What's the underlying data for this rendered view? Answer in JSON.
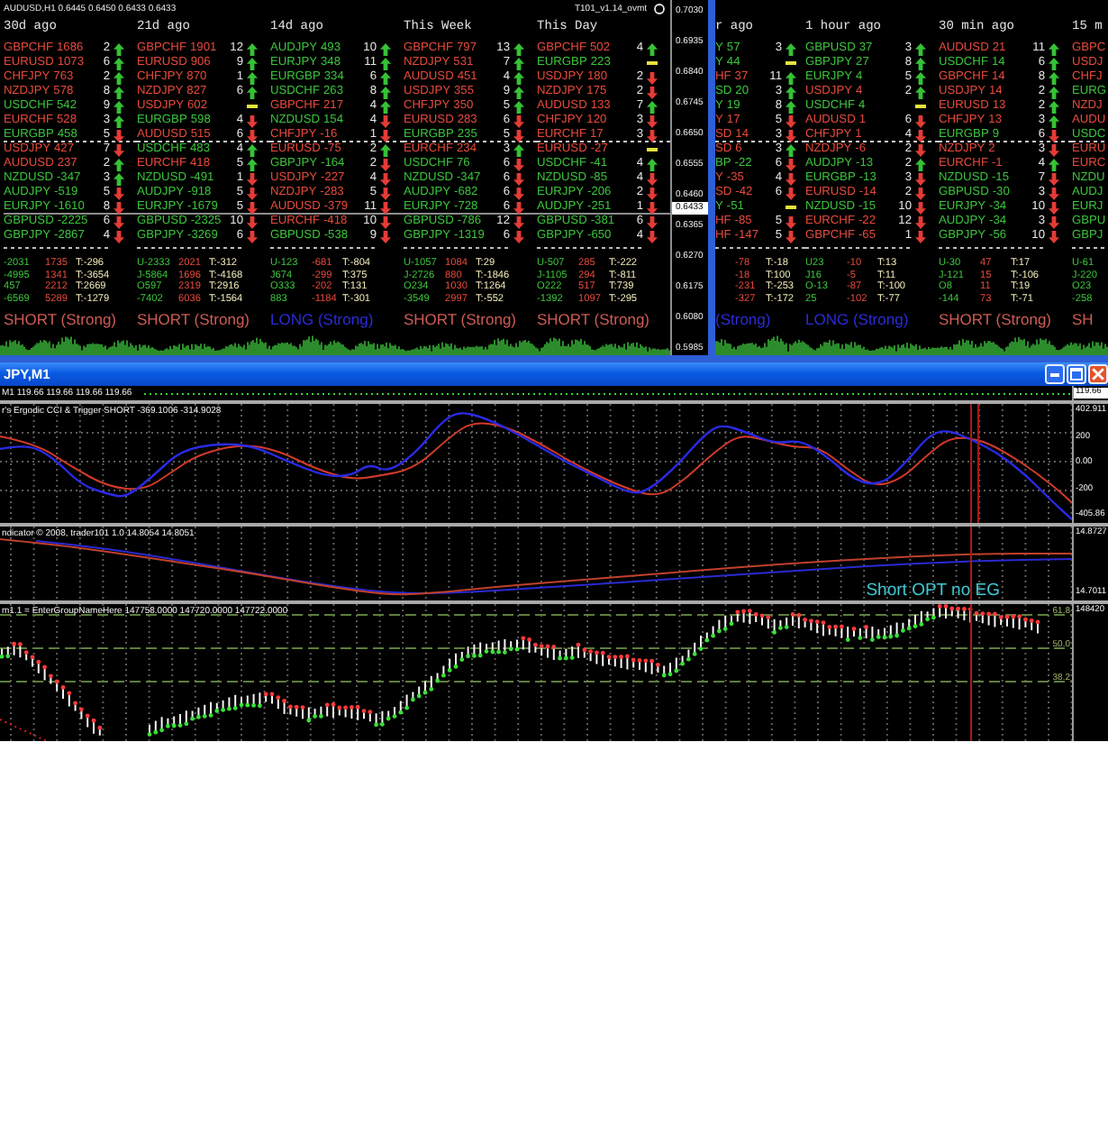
{
  "top_windows": [
    {
      "header": {
        "symbol": "AUDUSD,H1 0.6445 0.6450 0.6433 0.6433",
        "indicator": "T101_v1.14_ovmt"
      },
      "columns": [
        {
          "title": "30d ago",
          "rows": [
            {
              "pair": "GBPCHF",
              "value": "1686",
              "count": "2",
              "kind": "up",
              "color": "#e64a3c"
            },
            {
              "pair": "EURUSD",
              "value": "1073",
              "count": "6",
              "kind": "up",
              "color": "#e64a3c"
            },
            {
              "pair": "CHFJPY",
              "value": "763",
              "count": "2",
              "kind": "up",
              "color": "#e64a3c"
            },
            {
              "pair": "NZDJPY",
              "value": "578",
              "count": "8",
              "kind": "up",
              "color": "#e64a3c"
            },
            {
              "pair": "USDCHF",
              "value": "542",
              "count": "9",
              "kind": "up",
              "color": "#3cc33c"
            },
            {
              "pair": "EURCHF",
              "value": "528",
              "count": "3",
              "kind": "up",
              "color": "#e64a3c"
            },
            {
              "pair": "EURGBP",
              "value": "458",
              "count": "5",
              "kind": "down",
              "color": "#3cc33c"
            },
            {
              "pair": "USDJPY",
              "value": "427",
              "count": "7",
              "kind": "down",
              "color": "#e64a3c"
            },
            {
              "pair": "AUDUSD",
              "value": "237",
              "count": "2",
              "kind": "up",
              "color": "#e64a3c"
            },
            {
              "pair": "NZDUSD",
              "value": "-347",
              "count": "3",
              "kind": "up",
              "color": "#3cc33c"
            },
            {
              "pair": "AUDJPY",
              "value": "-519",
              "count": "5",
              "kind": "down",
              "color": "#3cc33c"
            },
            {
              "pair": "EURJPY",
              "value": "-1610",
              "count": "8",
              "kind": "down",
              "color": "#3cc33c"
            },
            {
              "pair": "GBPUSD",
              "value": "-2225",
              "count": "6",
              "kind": "down",
              "color": "#3cc33c"
            },
            {
              "pair": "GBPJPY",
              "value": "-2867",
              "count": "4",
              "kind": "down",
              "color": "#3cc33c"
            }
          ],
          "totals": [
            [
              "-2031",
              "1735",
              "T:-296"
            ],
            [
              "-4995",
              "1341",
              "T:-3654"
            ],
            [
              "457",
              "2212",
              "T:2669"
            ],
            [
              "-6569",
              "5289",
              "T:-1279"
            ]
          ],
          "signal": {
            "kind": "short",
            "text": "SHORT (Strong)"
          }
        },
        {
          "title": "21d ago",
          "rows": [
            {
              "pair": "GBPCHF",
              "value": "1901",
              "count": "12",
              "kind": "up",
              "color": "#e64a3c"
            },
            {
              "pair": "EURUSD",
              "value": "906",
              "count": "9",
              "kind": "up",
              "color": "#e64a3c"
            },
            {
              "pair": "CHFJPY",
              "value": "870",
              "count": "1",
              "kind": "up",
              "color": "#e64a3c"
            },
            {
              "pair": "NZDJPY",
              "value": "827",
              "count": "6",
              "kind": "up",
              "color": "#e64a3c"
            },
            {
              "pair": "USDJPY",
              "value": "602",
              "kind": "flat",
              "color": "#e64a3c"
            },
            {
              "pair": "EURGBP",
              "value": "598",
              "count": "4",
              "kind": "down",
              "color": "#3cc33c"
            },
            {
              "pair": "AUDUSD",
              "value": "515",
              "count": "6",
              "kind": "down",
              "color": "#e64a3c"
            },
            {
              "pair": "USDCHF",
              "value": "483",
              "count": "4",
              "kind": "up",
              "color": "#3cc33c"
            },
            {
              "pair": "EURCHF",
              "value": "418",
              "count": "5",
              "kind": "up",
              "color": "#e64a3c"
            },
            {
              "pair": "NZDUSD",
              "value": "-491",
              "count": "1",
              "kind": "down",
              "color": "#3cc33c"
            },
            {
              "pair": "AUDJPY",
              "value": "-918",
              "count": "5",
              "kind": "down",
              "color": "#3cc33c"
            },
            {
              "pair": "EURJPY",
              "value": "-1679",
              "count": "5",
              "kind": "down",
              "color": "#3cc33c"
            },
            {
              "pair": "GBPUSD",
              "value": "-2325",
              "count": "10",
              "kind": "down",
              "color": "#3cc33c"
            },
            {
              "pair": "GBPJPY",
              "value": "-3269",
              "count": "6",
              "kind": "down",
              "color": "#3cc33c"
            }
          ],
          "totals": [
            [
              "U-2333",
              "2021",
              "T:-312"
            ],
            [
              "J-5864",
              "1696",
              "T:-4168"
            ],
            [
              "O597",
              "2319",
              "T:2916"
            ],
            [
              "-7402",
              "6036",
              "T:-1564"
            ]
          ],
          "signal": {
            "kind": "short",
            "text": "SHORT (Strong)"
          }
        },
        {
          "title": "14d ago",
          "rows": [
            {
              "pair": "AUDJPY",
              "value": "493",
              "count": "10",
              "kind": "up",
              "color": "#3cc33c"
            },
            {
              "pair": "EURJPY",
              "value": "348",
              "count": "11",
              "kind": "up",
              "color": "#3cc33c"
            },
            {
              "pair": "EURGBP",
              "value": "334",
              "count": "6",
              "kind": "up",
              "color": "#3cc33c"
            },
            {
              "pair": "USDCHF",
              "value": "263",
              "count": "8",
              "kind": "up",
              "color": "#3cc33c"
            },
            {
              "pair": "GBPCHF",
              "value": "217",
              "count": "4",
              "kind": "up",
              "color": "#e64a3c"
            },
            {
              "pair": "NZDUSD",
              "value": "154",
              "count": "4",
              "kind": "down",
              "color": "#3cc33c"
            },
            {
              "pair": "CHFJPY",
              "value": "-16",
              "count": "1",
              "kind": "down",
              "color": "#e64a3c"
            },
            {
              "pair": "EURUSD",
              "value": "-75",
              "count": "2",
              "kind": "up",
              "color": "#e64a3c"
            },
            {
              "pair": "GBPJPY",
              "value": "-164",
              "count": "2",
              "kind": "down",
              "color": "#3cc33c"
            },
            {
              "pair": "USDJPY",
              "value": "-227",
              "count": "4",
              "kind": "down",
              "color": "#e64a3c"
            },
            {
              "pair": "NZDJPY",
              "value": "-283",
              "count": "5",
              "kind": "down",
              "color": "#e64a3c"
            },
            {
              "pair": "AUDUSD",
              "value": "-379",
              "count": "11",
              "kind": "down",
              "color": "#e64a3c"
            },
            {
              "pair": "EURCHF",
              "value": "-418",
              "count": "10",
              "kind": "down",
              "color": "#e64a3c"
            },
            {
              "pair": "GBPUSD",
              "value": "-538",
              "count": "9",
              "kind": "down",
              "color": "#3cc33c"
            }
          ],
          "totals": [
            [
              "U-123",
              "-681",
              "T:-804"
            ],
            [
              "J674",
              "-299",
              "T:375"
            ],
            [
              "O333",
              "-202",
              "T:131"
            ],
            [
              "883",
              "-1184",
              "T:-301"
            ]
          ],
          "signal": {
            "kind": "long",
            "text": "LONG (Strong)"
          }
        },
        {
          "title": "This Week",
          "rows": [
            {
              "pair": "GBPCHF",
              "value": "797",
              "count": "13",
              "kind": "up",
              "color": "#e64a3c"
            },
            {
              "pair": "NZDJPY",
              "value": "531",
              "count": "7",
              "kind": "up",
              "color": "#e64a3c"
            },
            {
              "pair": "AUDUSD",
              "value": "451",
              "count": "4",
              "kind": "up",
              "color": "#e64a3c"
            },
            {
              "pair": "USDJPY",
              "value": "355",
              "count": "9",
              "kind": "up",
              "color": "#e64a3c"
            },
            {
              "pair": "CHFJPY",
              "value": "350",
              "count": "5",
              "kind": "up",
              "color": "#e64a3c"
            },
            {
              "pair": "EURUSD",
              "value": "283",
              "count": "6",
              "kind": "down",
              "color": "#e64a3c"
            },
            {
              "pair": "EURGBP",
              "value": "235",
              "count": "5",
              "kind": "down",
              "color": "#3cc33c"
            },
            {
              "pair": "EURCHF",
              "value": "234",
              "count": "3",
              "kind": "up",
              "color": "#e64a3c"
            },
            {
              "pair": "USDCHF",
              "value": "76",
              "count": "6",
              "kind": "down",
              "color": "#3cc33c"
            },
            {
              "pair": "NZDUSD",
              "value": "-347",
              "count": "6",
              "kind": "down",
              "color": "#3cc33c"
            },
            {
              "pair": "AUDJPY",
              "value": "-682",
              "count": "6",
              "kind": "down",
              "color": "#3cc33c"
            },
            {
              "pair": "EURJPY",
              "value": "-728",
              "count": "6",
              "kind": "down",
              "color": "#3cc33c"
            },
            {
              "pair": "GBPUSD",
              "value": "-786",
              "count": "12",
              "kind": "down",
              "color": "#3cc33c"
            },
            {
              "pair": "GBPJPY",
              "value": "-1319",
              "count": "6",
              "kind": "down",
              "color": "#3cc33c"
            }
          ],
          "totals": [
            [
              "U-1057",
              "1084",
              "T:29"
            ],
            [
              "J-2726",
              "880",
              "T:-1846"
            ],
            [
              "O234",
              "1030",
              "T:1264"
            ],
            [
              "-3549",
              "2997",
              "T:-552"
            ]
          ],
          "signal": {
            "kind": "short",
            "text": "SHORT (Strong)"
          }
        },
        {
          "title": "This Day",
          "rows": [
            {
              "pair": "GBPCHF",
              "value": "502",
              "count": "4",
              "kind": "up",
              "color": "#e64a3c"
            },
            {
              "pair": "EURGBP",
              "value": "223",
              "kind": "flat",
              "color": "#3cc33c"
            },
            {
              "pair": "USDJPY",
              "value": "180",
              "count": "2",
              "kind": "down",
              "color": "#e64a3c"
            },
            {
              "pair": "NZDJPY",
              "value": "175",
              "count": "2",
              "kind": "down",
              "color": "#e64a3c"
            },
            {
              "pair": "AUDUSD",
              "value": "133",
              "count": "7",
              "kind": "up",
              "color": "#e64a3c"
            },
            {
              "pair": "CHFJPY",
              "value": "120",
              "count": "3",
              "kind": "down",
              "color": "#e64a3c"
            },
            {
              "pair": "EURCHF",
              "value": "17",
              "count": "3",
              "kind": "down",
              "color": "#e64a3c"
            },
            {
              "pair": "EURUSD",
              "value": "-27",
              "kind": "flat",
              "color": "#e64a3c"
            },
            {
              "pair": "USDCHF",
              "value": "-41",
              "count": "4",
              "kind": "up",
              "color": "#3cc33c"
            },
            {
              "pair": "NZDUSD",
              "value": "-85",
              "count": "4",
              "kind": "down",
              "color": "#3cc33c"
            },
            {
              "pair": "EURJPY",
              "value": "-206",
              "count": "2",
              "kind": "down",
              "color": "#3cc33c"
            },
            {
              "pair": "AUDJPY",
              "value": "-251",
              "count": "1",
              "kind": "down",
              "color": "#3cc33c"
            },
            {
              "pair": "GBPUSD",
              "value": "-381",
              "count": "6",
              "kind": "down",
              "color": "#3cc33c"
            },
            {
              "pair": "GBPJPY",
              "value": "-650",
              "count": "4",
              "kind": "down",
              "color": "#3cc33c"
            }
          ],
          "totals": [
            [
              "U-507",
              "285",
              "T:-222"
            ],
            [
              "J-1105",
              "294",
              "T:-811"
            ],
            [
              "O222",
              "517",
              "T:739"
            ],
            [
              "-1392",
              "1097",
              "T:-295"
            ]
          ],
          "signal": {
            "kind": "short",
            "text": "SHORT (Strong)"
          }
        }
      ],
      "price_scale": [
        {
          "label": "0.7030",
          "current": false
        },
        {
          "label": "0.6935",
          "current": false
        },
        {
          "label": "0.6840",
          "current": false
        },
        {
          "label": "0.6745",
          "current": false
        },
        {
          "label": "0.6650",
          "current": false
        },
        {
          "label": "0.6555",
          "current": false
        },
        {
          "label": "0.6460",
          "current": false
        },
        {
          "label": "0.6433",
          "current": true
        },
        {
          "label": "0.6365",
          "current": false
        },
        {
          "label": "0.6270",
          "current": false
        },
        {
          "label": "0.6175",
          "current": false
        },
        {
          "label": "0.6080",
          "current": false
        },
        {
          "label": "0.5985",
          "current": false
        }
      ]
    },
    {
      "columns": [
        {
          "title": "r ago",
          "rows": [
            {
              "pair": "Y",
              "value": "57",
              "count": "3",
              "kind": "up",
              "color": "#3cc33c"
            },
            {
              "pair": "Y",
              "value": "44",
              "kind": "flat",
              "color": "#3cc33c"
            },
            {
              "pair": "HF",
              "value": "37",
              "count": "11",
              "kind": "up",
              "color": "#e64a3c"
            },
            {
              "pair": "SD",
              "value": "20",
              "count": "3",
              "kind": "up",
              "color": "#3cc33c"
            },
            {
              "pair": "Y",
              "value": "19",
              "count": "8",
              "kind": "up",
              "color": "#3cc33c"
            },
            {
              "pair": "Y",
              "value": "17",
              "count": "5",
              "kind": "down",
              "color": "#e64a3c"
            },
            {
              "pair": "SD",
              "value": "14",
              "count": "3",
              "kind": "down",
              "color": "#e64a3c"
            },
            {
              "pair": "SD",
              "value": "6",
              "count": "3",
              "kind": "up",
              "color": "#e64a3c"
            },
            {
              "pair": "BP",
              "value": "-22",
              "count": "6",
              "kind": "down",
              "color": "#3cc33c"
            },
            {
              "pair": "Y",
              "value": "-35",
              "count": "4",
              "kind": "down",
              "color": "#e64a3c"
            },
            {
              "pair": "SD",
              "value": "-42",
              "count": "6",
              "kind": "down",
              "color": "#e64a3c"
            },
            {
              "pair": "Y",
              "value": "-51",
              "kind": "flat",
              "color": "#3cc33c"
            },
            {
              "pair": "HF",
              "value": "-85",
              "count": "5",
              "kind": "down",
              "color": "#e64a3c"
            },
            {
              "pair": "HF",
              "value": "-147",
              "count": "5",
              "kind": "down",
              "color": "#e64a3c"
            }
          ],
          "totals": [
            [
              "-78",
              "T:-18"
            ],
            [
              "-18",
              "T:100"
            ],
            [
              "-231",
              "T:-253"
            ],
            [
              "-327",
              "T:-172"
            ]
          ],
          "signal": {
            "kind": "long",
            "text": "(Strong)"
          }
        },
        {
          "title": "1 hour ago",
          "rows": [
            {
              "pair": "GBPUSD",
              "value": "37",
              "count": "3",
              "kind": "up",
              "color": "#3cc33c"
            },
            {
              "pair": "GBPJPY",
              "value": "27",
              "count": "8",
              "kind": "up",
              "color": "#3cc33c"
            },
            {
              "pair": "EURJPY",
              "value": "4",
              "count": "5",
              "kind": "up",
              "color": "#3cc33c"
            },
            {
              "pair": "USDJPY",
              "value": "4",
              "count": "2",
              "kind": "up",
              "color": "#e64a3c"
            },
            {
              "pair": "USDCHF",
              "value": "4",
              "kind": "flat",
              "color": "#3cc33c"
            },
            {
              "pair": "AUDUSD",
              "value": "1",
              "count": "6",
              "kind": "down",
              "color": "#e64a3c"
            },
            {
              "pair": "CHFJPY",
              "value": "1",
              "count": "4",
              "kind": "down",
              "color": "#e64a3c"
            },
            {
              "pair": "NZDJPY",
              "value": "-6",
              "count": "2",
              "kind": "down",
              "color": "#e64a3c"
            },
            {
              "pair": "AUDJPY",
              "value": "-13",
              "count": "2",
              "kind": "up",
              "color": "#3cc33c"
            },
            {
              "pair": "EURGBP",
              "value": "-13",
              "count": "3",
              "kind": "down",
              "color": "#3cc33c"
            },
            {
              "pair": "EURUSD",
              "value": "-14",
              "count": "2",
              "kind": "down",
              "color": "#e64a3c"
            },
            {
              "pair": "NZDUSD",
              "value": "-15",
              "count": "10",
              "kind": "down",
              "color": "#3cc33c"
            },
            {
              "pair": "EURCHF",
              "value": "-22",
              "count": "12",
              "kind": "down",
              "color": "#e64a3c"
            },
            {
              "pair": "GBPCHF",
              "value": "-65",
              "count": "1",
              "kind": "down",
              "color": "#e64a3c"
            }
          ],
          "totals": [
            [
              "U23",
              "-10",
              "T:13"
            ],
            [
              "J16",
              "-5",
              "T:11"
            ],
            [
              "O-13",
              "-87",
              "T:-100"
            ],
            [
              "25",
              "-102",
              "T:-77"
            ]
          ],
          "signal": {
            "kind": "long",
            "text": "LONG (Strong)"
          }
        },
        {
          "title": "30 min ago",
          "rows": [
            {
              "pair": "AUDUSD",
              "value": "21",
              "count": "11",
              "kind": "up",
              "color": "#e64a3c"
            },
            {
              "pair": "USDCHF",
              "value": "14",
              "count": "6",
              "kind": "up",
              "color": "#3cc33c"
            },
            {
              "pair": "GBPCHF",
              "value": "14",
              "count": "8",
              "kind": "up",
              "color": "#e64a3c"
            },
            {
              "pair": "USDJPY",
              "value": "14",
              "count": "2",
              "kind": "up",
              "color": "#e64a3c"
            },
            {
              "pair": "EURUSD",
              "value": "13",
              "count": "2",
              "kind": "up",
              "color": "#e64a3c"
            },
            {
              "pair": "CHFJPY",
              "value": "13",
              "count": "3",
              "kind": "up",
              "color": "#e64a3c"
            },
            {
              "pair": "EURGBP",
              "value": "9",
              "count": "6",
              "kind": "down",
              "color": "#3cc33c"
            },
            {
              "pair": "NZDJPY",
              "value": "2",
              "count": "3",
              "kind": "down",
              "color": "#e64a3c"
            },
            {
              "pair": "EURCHF",
              "value": "-1",
              "count": "4",
              "kind": "up",
              "color": "#e64a3c"
            },
            {
              "pair": "NZDUSD",
              "value": "-15",
              "count": "7",
              "kind": "down",
              "color": "#3cc33c"
            },
            {
              "pair": "GBPUSD",
              "value": "-30",
              "count": "3",
              "kind": "down",
              "color": "#3cc33c"
            },
            {
              "pair": "EURJPY",
              "value": "-34",
              "count": "10",
              "kind": "down",
              "color": "#3cc33c"
            },
            {
              "pair": "AUDJPY",
              "value": "-34",
              "count": "3",
              "kind": "down",
              "color": "#3cc33c"
            },
            {
              "pair": "GBPJPY",
              "value": "-56",
              "count": "10",
              "kind": "down",
              "color": "#3cc33c"
            }
          ],
          "totals": [
            [
              "U-30",
              "47",
              "T:17"
            ],
            [
              "J-121",
              "15",
              "T:-106"
            ],
            [
              "O8",
              "11",
              "T:19"
            ],
            [
              "-144",
              "73",
              "T:-71"
            ]
          ],
          "signal": {
            "kind": "short",
            "text": "SHORT (Strong)"
          }
        },
        {
          "title": "15 m",
          "rows": [
            {
              "pair": "GBPC",
              "color": "#e64a3c"
            },
            {
              "pair": "USDJ",
              "color": "#e64a3c"
            },
            {
              "pair": "CHFJ",
              "color": "#e64a3c"
            },
            {
              "pair": "EURG",
              "color": "#3cc33c"
            },
            {
              "pair": "NZDJ",
              "color": "#e64a3c"
            },
            {
              "pair": "AUDU",
              "color": "#e64a3c"
            },
            {
              "pair": "USDC",
              "color": "#3cc33c"
            },
            {
              "pair": "EURU",
              "color": "#e64a3c"
            },
            {
              "pair": "EURC",
              "color": "#e64a3c"
            },
            {
              "pair": "NZDU",
              "color": "#3cc33c"
            },
            {
              "pair": "AUDJ",
              "color": "#3cc33c"
            },
            {
              "pair": "EURJ",
              "color": "#3cc33c"
            },
            {
              "pair": "GBPU",
              "color": "#3cc33c"
            },
            {
              "pair": "GBPJ",
              "color": "#3cc33c"
            }
          ],
          "totals": [
            [
              "U-61"
            ],
            [
              "J-220"
            ],
            [
              "O23"
            ],
            [
              "-258"
            ]
          ],
          "signal": {
            "kind": "short",
            "text": "SH"
          }
        }
      ]
    }
  ],
  "chart_window": {
    "title": "JPY,M1",
    "panes": [
      {
        "kind": "price",
        "label": "M1 119.66 119.66 119.66 119.66",
        "scale": [
          {
            "label": "119.66",
            "current": true
          }
        ]
      },
      {
        "kind": "oscillator",
        "label": "r's Ergodic CCI & Trigger SHORT -369.1006 -314.9028",
        "scale": [
          {
            "label": "402.911",
            "current": false
          },
          {
            "label": "200",
            "current": false
          },
          {
            "label": "0.00",
            "current": false
          },
          {
            "label": "-200",
            "current": false
          },
          {
            "label": "-405.86",
            "current": false
          }
        ]
      },
      {
        "kind": "lines",
        "label": "ndicator © 2008, trader101 1.0 14.8054 14.8051",
        "scale": [
          {
            "label": "14.8727",
            "current": false
          },
          {
            "label": "14.7011",
            "current": false
          }
        ],
        "note": "Short OPT no EG"
      },
      {
        "kind": "bars",
        "label": "m1.1 = EnterGroupNameHere 147758.0000 147720.0000 147722.0000",
        "scale": [
          {
            "label": "148420",
            "current": false
          }
        ],
        "levels": [
          "61.8",
          "50.0",
          "38.2"
        ]
      }
    ]
  }
}
